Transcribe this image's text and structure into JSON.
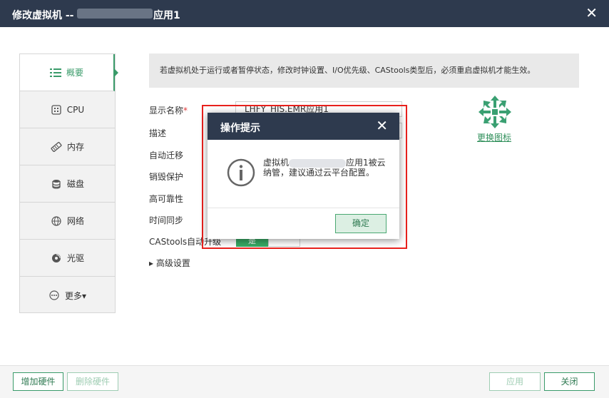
{
  "window": {
    "title_prefix": "修改虚拟机 --",
    "title_suffix": "应用1"
  },
  "nav": {
    "items": [
      {
        "label": "概要",
        "icon": "list-icon",
        "active": true
      },
      {
        "label": "CPU",
        "icon": "cpu-icon"
      },
      {
        "label": "内存",
        "icon": "memory-icon"
      },
      {
        "label": "磁盘",
        "icon": "disk-icon"
      },
      {
        "label": "网络",
        "icon": "network-icon"
      },
      {
        "label": "光驱",
        "icon": "cdrom-icon"
      },
      {
        "label": "更多▾",
        "icon": "more-icon"
      }
    ]
  },
  "notice": "若虚拟机处于运行或者暂停状态，修改时钟设置、I/O优先级、CAStools类型后，必须重启虚拟机才能生效。",
  "form": {
    "display_name_label": "显示名称",
    "required_mark": "*",
    "display_name_value": "LHFY_HIS.EMR应用1",
    "description_label": "描述",
    "auto_migrate_label": "自动迁移",
    "destroy_protect_label": "销毁保护",
    "high_availability_label": "高可靠性",
    "time_sync_label": "时间同步",
    "castools_upgrade_label": "CAStools自动升级",
    "castools_upgrade_value": "是",
    "advanced_label": "▸ 高级设置"
  },
  "icon_panel": {
    "change_icon_label": "更换图标"
  },
  "footer": {
    "add_hardware": "增加硬件",
    "remove_hardware": "删除硬件",
    "apply": "应用",
    "close": "关闭"
  },
  "modal": {
    "title": "操作提示",
    "message_prefix": "虚拟机",
    "message_suffix": "应用1被云纳管，建议通过云平台配置。",
    "ok_label": "确定"
  },
  "colors": {
    "titlebar": "#2e3a4e",
    "accent": "#3a9b6a",
    "highlight_frame": "#e8211d"
  }
}
